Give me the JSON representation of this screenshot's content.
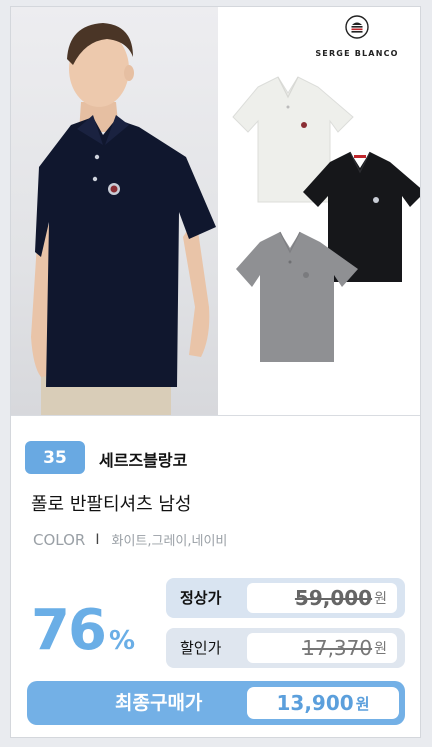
{
  "brand_logo_name": "SERGE BLANCO",
  "rank": "35",
  "brand": "세르즈블랑코",
  "product_name": "폴로 반팔티셔츠 남성",
  "color": {
    "label": "COLOR",
    "separator": "I",
    "values": "화이트,그레이,네이비"
  },
  "discount": {
    "value": "76",
    "unit": "%"
  },
  "regular_price": {
    "label": "정상가",
    "value": "59,000",
    "unit": "원"
  },
  "sale_price": {
    "label": "할인가",
    "value": "17,370",
    "unit": "원"
  },
  "final_price": {
    "label": "최종구매가",
    "value": "13,900",
    "unit": "원"
  },
  "colors": {
    "accent": "#69a9e2",
    "navy": "#10172e",
    "white_shirt": "#eeefeb",
    "black_shirt": "#16171a",
    "grey_shirt": "#8f9093"
  }
}
